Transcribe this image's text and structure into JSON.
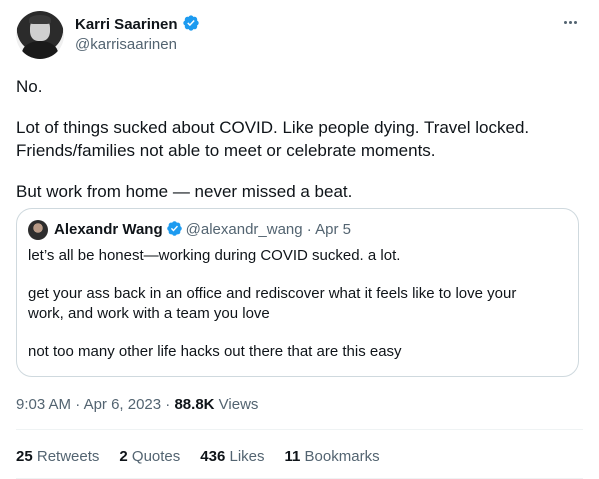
{
  "author": {
    "name": "Karri Saarinen",
    "handle": "@karrisaarinen"
  },
  "tweet": {
    "paragraphs": [
      "No.",
      "Lot of things sucked about COVID. Like people dying. Travel locked.",
      "Friends/families not able to meet or celebrate moments.",
      "But work from home — never missed a beat."
    ]
  },
  "quote": {
    "name": "Alexandr Wang",
    "handle": "@alexandr_wang",
    "separator": "·",
    "date": "Apr 5",
    "paragraphs": [
      "let’s all be honest—working during COVID sucked. a lot.",
      "get your ass back in an office and rediscover what it feels like to love your",
      "work, and work with a team you love",
      "not too many other life hacks out there that are this easy"
    ]
  },
  "meta": {
    "time": "9:03 AM",
    "separator1": "·",
    "date": "Apr 6, 2023",
    "separator2": "·",
    "views_count": "88.8K",
    "views_label": "Views"
  },
  "stats": {
    "retweets_count": "25",
    "retweets_label": "Retweets",
    "quotes_count": "2",
    "quotes_label": "Quotes",
    "likes_count": "436",
    "likes_label": "Likes",
    "bookmarks_count": "11",
    "bookmarks_label": "Bookmarks"
  },
  "colors": {
    "verified": "#1d9bf0",
    "secondary_text": "#536471",
    "primary_text": "#0f1419",
    "border": "#cfd9de"
  },
  "icons": {
    "verified": "verified-badge-icon",
    "more": "more-horizontal-icon"
  }
}
